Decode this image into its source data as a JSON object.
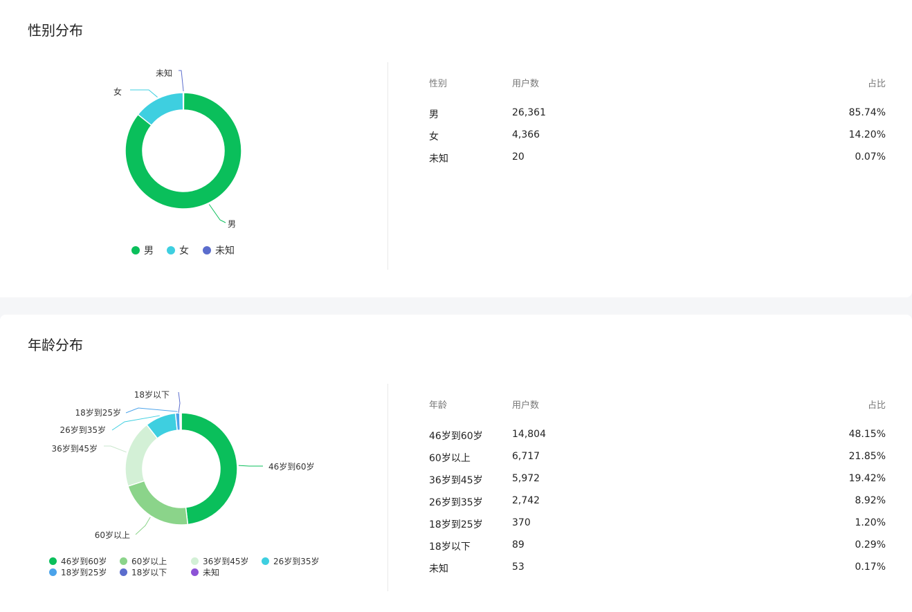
{
  "gender": {
    "title": "性别分布",
    "table": {
      "headers": {
        "name": "性别",
        "count": "用户数",
        "pct": "占比"
      },
      "rows": [
        {
          "name": "男",
          "count": "26,361",
          "pct": "85.74%"
        },
        {
          "name": "女",
          "count": "4,366",
          "pct": "14.20%"
        },
        {
          "name": "未知",
          "count": "20",
          "pct": "0.07%"
        }
      ]
    }
  },
  "age": {
    "title": "年龄分布",
    "table": {
      "headers": {
        "name": "年龄",
        "count": "用户数",
        "pct": "占比"
      },
      "rows": [
        {
          "name": "46岁到60岁",
          "count": "14,804",
          "pct": "48.15%"
        },
        {
          "name": "60岁以上",
          "count": "6,717",
          "pct": "21.85%"
        },
        {
          "name": "36岁到45岁",
          "count": "5,972",
          "pct": "19.42%"
        },
        {
          "name": "26岁到35岁",
          "count": "2,742",
          "pct": "8.92%"
        },
        {
          "name": "18岁到25岁",
          "count": "370",
          "pct": "1.20%"
        },
        {
          "name": "18岁以下",
          "count": "89",
          "pct": "0.29%"
        },
        {
          "name": "未知",
          "count": "53",
          "pct": "0.17%"
        }
      ]
    }
  },
  "chart_data": [
    {
      "type": "pie",
      "variant": "donut",
      "title": "性别分布",
      "categories": [
        "男",
        "女",
        "未知"
      ],
      "values": [
        26361,
        4366,
        20
      ],
      "colors": [
        "#0abf5b",
        "#3ecfe0",
        "#5b6dcd"
      ],
      "legend_position": "bottom"
    },
    {
      "type": "pie",
      "variant": "donut",
      "title": "年龄分布",
      "categories": [
        "46岁到60岁",
        "60岁以上",
        "36岁到45岁",
        "26岁到35岁",
        "18岁到25岁",
        "18岁以下",
        "未知"
      ],
      "values": [
        14804,
        6717,
        5972,
        2742,
        370,
        89,
        53
      ],
      "colors": [
        "#0abf5b",
        "#8bd48a",
        "#d3f0d6",
        "#3ecfe0",
        "#4ba3ea",
        "#5b6dcd",
        "#8c52d6"
      ],
      "legend_position": "bottom"
    }
  ]
}
